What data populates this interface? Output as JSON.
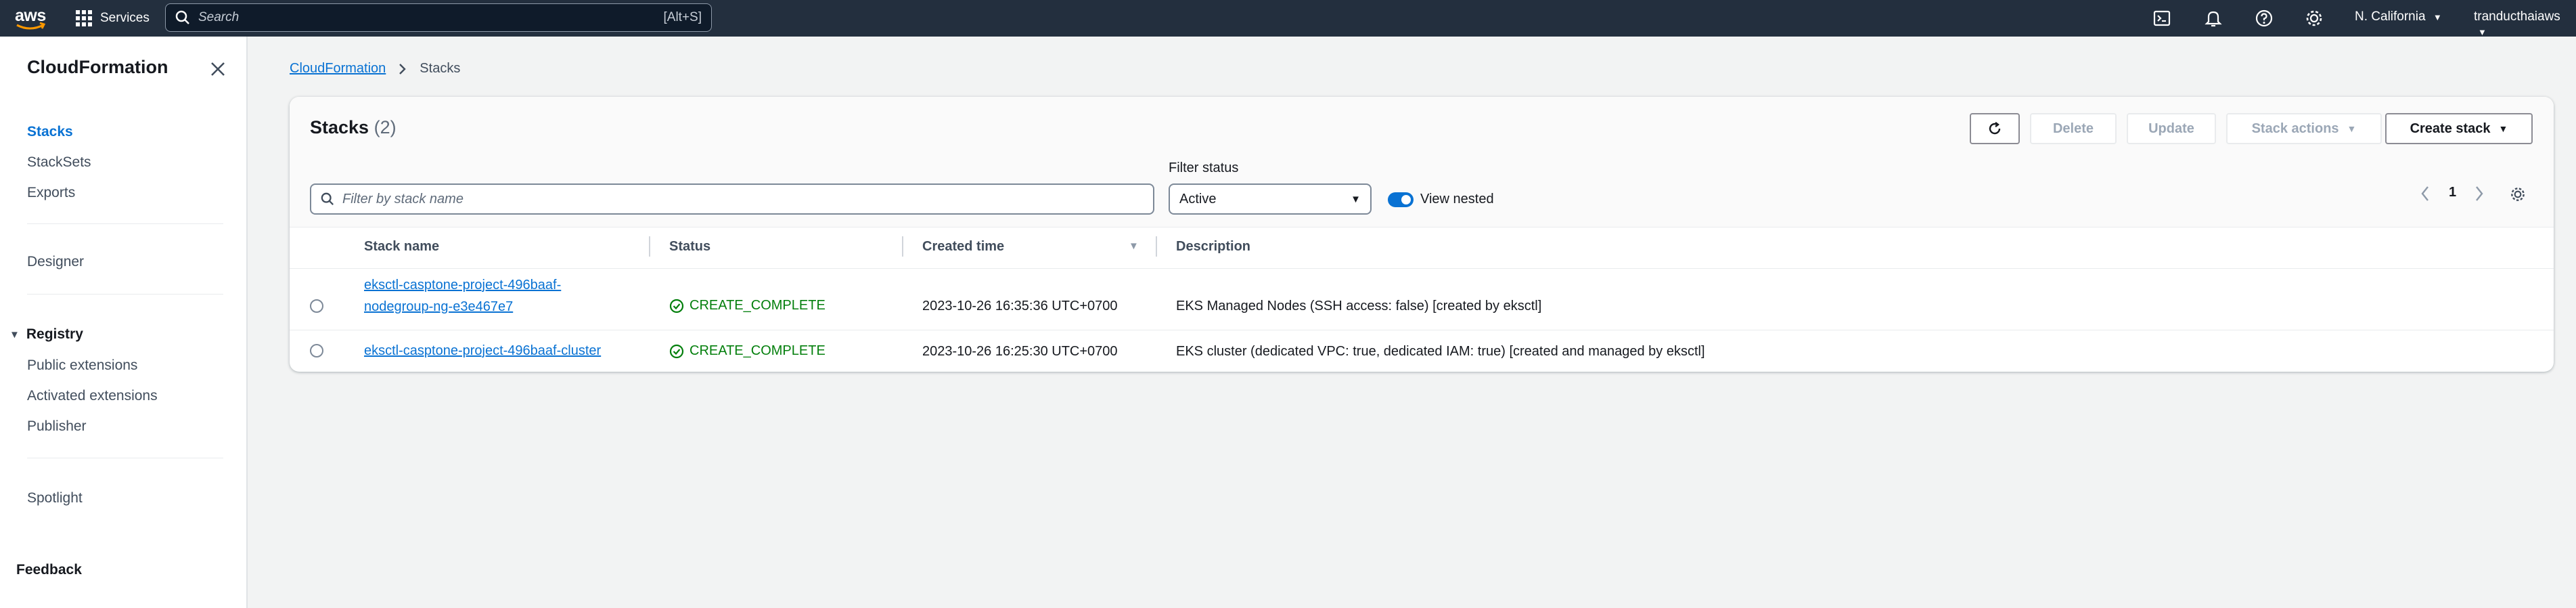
{
  "topnav": {
    "logo": "aws",
    "services_label": "Services",
    "search_placeholder": "Search",
    "search_shortcut": "[Alt+S]",
    "icons": [
      "cloudshell-icon",
      "bell-icon",
      "help-icon",
      "gear-icon"
    ],
    "region": "N. California",
    "account": "tranducthaiaws"
  },
  "sidenav": {
    "title": "CloudFormation",
    "items": [
      "Stacks",
      "StackSets",
      "Exports"
    ],
    "designer": "Designer",
    "registry": {
      "label": "Registry",
      "items": [
        "Public extensions",
        "Activated extensions",
        "Publisher"
      ]
    },
    "spotlight": "Spotlight",
    "feedback": "Feedback"
  },
  "breadcrumb": {
    "root": "CloudFormation",
    "current": "Stacks"
  },
  "stacks_panel": {
    "title": "Stacks",
    "count": "(2)",
    "buttons": {
      "delete": "Delete",
      "update": "Update",
      "stack_actions": "Stack actions",
      "create_stack": "Create stack"
    },
    "filter_placeholder": "Filter by stack name",
    "filter_status_label": "Filter status",
    "filter_status_value": "Active",
    "view_nested_label": "View nested",
    "view_nested_on": true,
    "page_number": "1",
    "columns": [
      "Stack name",
      "Status",
      "Created time",
      "Description"
    ],
    "rows": [
      {
        "name_line1": "eksctl-casptone-project-496baaf-",
        "name_line2": "nodegroup-ng-e3e467e7",
        "status": "CREATE_COMPLETE",
        "created": "2023-10-26 16:35:36 UTC+0700",
        "description": "EKS Managed Nodes (SSH access: false) [created by eksctl]"
      },
      {
        "name_line1": "eksctl-casptone-project-496baaf-cluster",
        "name_line2": "",
        "status": "CREATE_COMPLETE",
        "created": "2023-10-26 16:25:30 UTC+0700",
        "description": "EKS cluster (dedicated VPC: true, dedicated IAM: true) [created and managed by eksctl]"
      }
    ]
  },
  "colors": {
    "nav_bg": "#232f3e",
    "link": "#0972d3",
    "success": "#037f0c"
  }
}
